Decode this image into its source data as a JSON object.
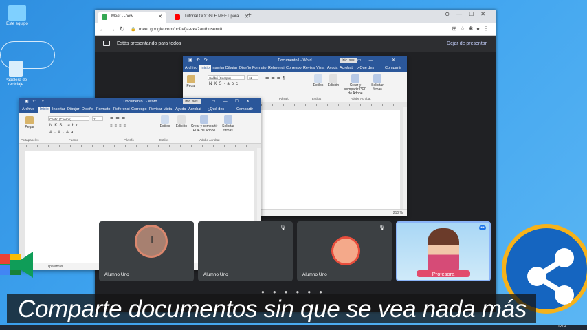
{
  "desktop": {
    "icons": [
      {
        "label": "Este equipo",
        "color": "#7fd0ff"
      },
      {
        "label": "Papelera de reciclaje",
        "color": "#d9eefc"
      }
    ]
  },
  "browser": {
    "tabs": [
      {
        "label": "Meet - ‐new",
        "active": true,
        "favicon_color": "#34a853"
      },
      {
        "label": "Tutorial GOOGLE MEET para",
        "active": false,
        "favicon_color": "#ff0000"
      }
    ],
    "url": "meet.google.com/pcf-vfja-vxa?authuser=0",
    "presenting_text": "Estás presentando para todos",
    "stop_presenting": "Dejar de presentar"
  },
  "word": {
    "title": "Documento1 - Word",
    "sign_in": "Inic. ses.",
    "tabs": [
      "Archivo",
      "Inicio",
      "Insertar",
      "Dibujar",
      "Diseño",
      "Formato",
      "Referenci",
      "Correspo",
      "Revisar",
      "Vista",
      "Ayuda",
      "Acrobat",
      "¿Qué des",
      "Compartir"
    ],
    "font_name": "Calibri (Cuerpo)",
    "font_size": "11",
    "paste_label": "Pegar",
    "styles_label": "Estilos",
    "editing_label": "Edición",
    "create_pdf": "Crear y compartir PDF de Adobe",
    "request_sign": "Solicitar firmas",
    "group_clipboard": "Portapapeles",
    "group_font": "Fuente",
    "group_paragraph": "Párrafo",
    "group_styles": "Estilos",
    "group_acrobat": "Adobe Acrobat",
    "word_count": "0 palabras",
    "zoom": "210 %"
  },
  "meet": {
    "tiles": [
      {
        "name": "Alumno Uno"
      },
      {
        "name": "Alumno Uno"
      },
      {
        "name": "Alumno Uno"
      },
      {
        "name": "Profesora"
      }
    ]
  },
  "caption": "Comparte documentos sin que se vea nada más",
  "clock": "12:04",
  "colors": {
    "word_blue": "#2b579a",
    "meet_dark": "#202124",
    "caption_bg": "#141414",
    "share_ring": "#f6b21a"
  }
}
